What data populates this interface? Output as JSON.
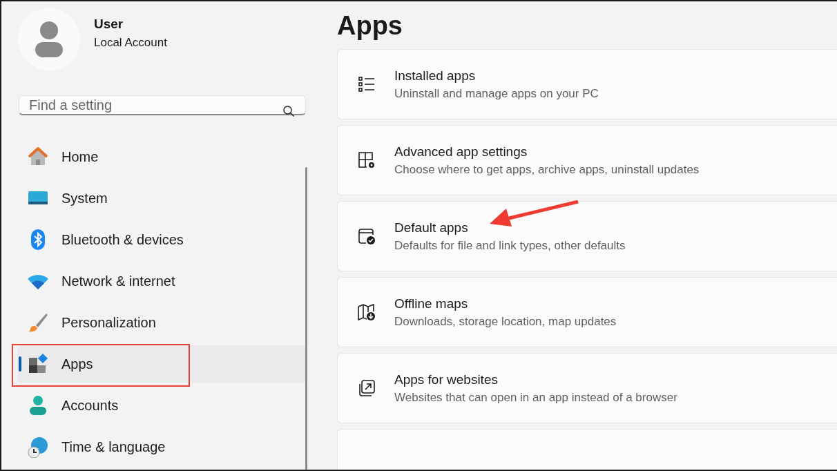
{
  "profile": {
    "name": "User",
    "account": "Local Account"
  },
  "search": {
    "placeholder": "Find a setting"
  },
  "nav": [
    {
      "kind": "home",
      "label": "Home",
      "selected": false,
      "highlighted": false
    },
    {
      "kind": "system",
      "label": "System",
      "selected": false,
      "highlighted": false
    },
    {
      "kind": "bluetooth",
      "label": "Bluetooth & devices",
      "selected": false,
      "highlighted": false
    },
    {
      "kind": "network",
      "label": "Network & internet",
      "selected": false,
      "highlighted": false
    },
    {
      "kind": "personalization",
      "label": "Personalization",
      "selected": false,
      "highlighted": false
    },
    {
      "kind": "apps",
      "label": "Apps",
      "selected": true,
      "highlighted": true
    },
    {
      "kind": "accounts",
      "label": "Accounts",
      "selected": false,
      "highlighted": false
    },
    {
      "kind": "time",
      "label": "Time & language",
      "selected": false,
      "highlighted": false
    }
  ],
  "page_title": "Apps",
  "cards": [
    {
      "kind": "list",
      "title": "Installed apps",
      "subtitle": "Uninstall and manage apps on your PC",
      "pointed": false
    },
    {
      "kind": "advanced",
      "title": "Advanced app settings",
      "subtitle": "Choose where to get apps, archive apps, uninstall updates",
      "pointed": false
    },
    {
      "kind": "default",
      "title": "Default apps",
      "subtitle": "Defaults for file and link types, other defaults",
      "pointed": true
    },
    {
      "kind": "map",
      "title": "Offline maps",
      "subtitle": "Downloads, storage location, map updates",
      "pointed": false
    },
    {
      "kind": "web",
      "title": "Apps for websites",
      "subtitle": "Websites that can open in an app instead of a browser",
      "pointed": false
    },
    {
      "kind": "empty",
      "pointed": false
    }
  ]
}
